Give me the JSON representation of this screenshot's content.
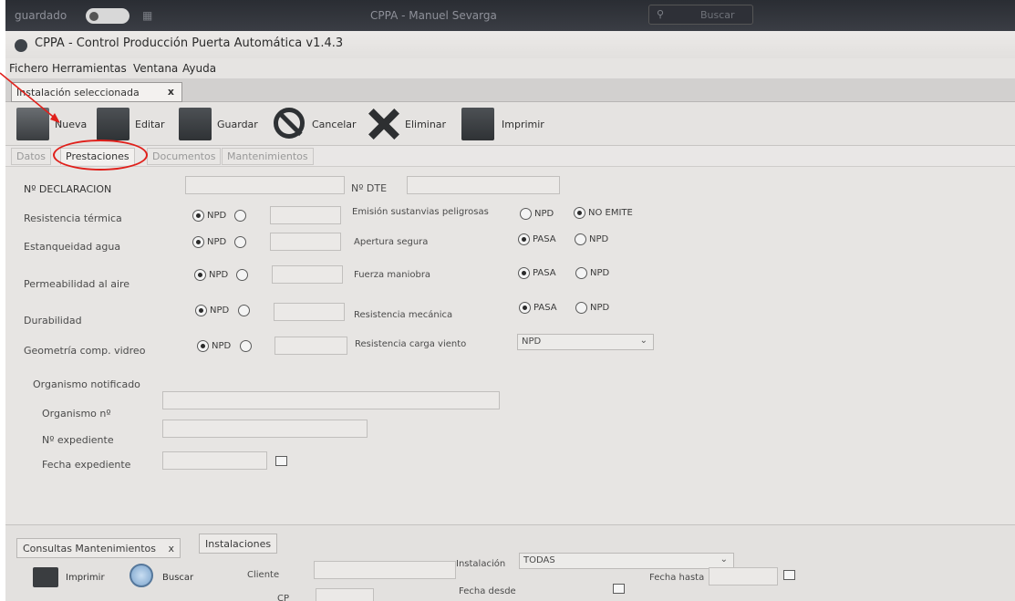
{
  "system_bar": {
    "left_label": "guardado",
    "center_label": "CPPA - Manuel Sevarga",
    "search_label": "Buscar"
  },
  "window": {
    "title": "CPPA - Control Producción Puerta Automática v1.4.3"
  },
  "menu": [
    "Fichero",
    "Herramientas",
    "Ventana",
    "Ayuda"
  ],
  "doc_tab": {
    "label": "Instalación seleccionada",
    "close": "x"
  },
  "toolbar": {
    "nueva": "Nueva",
    "editar": "Editar",
    "guardar": "Guardar",
    "cancelar": "Cancelar",
    "eliminar": "Eliminar",
    "imprimir": "Imprimir"
  },
  "subtabs": {
    "datos": "Datos",
    "prestaciones": "Prestaciones",
    "documentos": "Documentos",
    "mantenimientos": "Mantenimientos"
  },
  "form": {
    "n_declaracion": "Nº DECLARACION",
    "n_dte": "Nº DTE",
    "left_rows": [
      {
        "label": "Resistencia térmica",
        "opt": "NPD"
      },
      {
        "label": "Estanqueidad agua",
        "opt": "NPD"
      },
      {
        "label": "Permeabilidad al aire",
        "opt": "NPD"
      },
      {
        "label": "Durabilidad",
        "opt": "NPD"
      },
      {
        "label": "Geometría comp. vidreo",
        "opt": "NPD"
      }
    ],
    "emision": {
      "label": "Emisión sustanvias peligrosas",
      "opt1": "NPD",
      "opt2": "NO EMITE"
    },
    "apertura": {
      "label": "Apertura segura",
      "opt1": "PASA",
      "opt2": "NPD"
    },
    "fuerza": {
      "label": "Fuerza maniobra",
      "opt1": "PASA",
      "opt2": "NPD"
    },
    "resistencia_mec": {
      "label": "Resistencia mecánica",
      "opt1": "PASA",
      "opt2": "NPD"
    },
    "carga_viento": {
      "label": "Resistencia carga viento",
      "value": "NPD"
    },
    "organismo": {
      "section": "Organismo notificado",
      "numero": "Organismo nº",
      "expediente": "Nº expediente",
      "fecha": "Fecha expediente"
    }
  },
  "bottom": {
    "tab1": "Consultas Mantenimientos",
    "tab1_close": "x",
    "tab2": "Instalaciones",
    "imprimir": "Imprimir",
    "buscar": "Buscar",
    "cliente": "Cliente",
    "cp": "CP",
    "instalacion_label": "Instalación",
    "instalacion_value": "TODAS",
    "fecha_desde": "Fecha desde",
    "fecha_hasta": "Fecha hasta"
  },
  "colors": {
    "annotation": "#e0201b",
    "window_bg": "#e7e5e3"
  }
}
